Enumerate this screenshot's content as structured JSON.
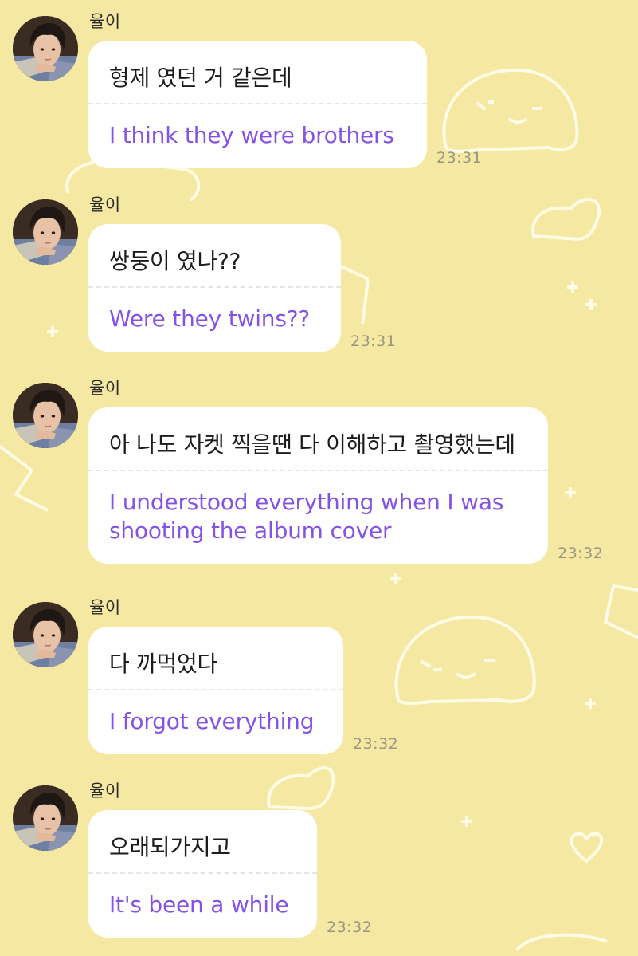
{
  "theme": {
    "background": "#f4e8a2",
    "bubble": "#ffffff",
    "original_text_color": "#1c1c1c",
    "translation_color": "#8553e4",
    "timestamp_color": "#9a9781",
    "doodle_color": "#fffbe6"
  },
  "messages": [
    {
      "sender": "율이",
      "original": "형제 였던 거 같은데",
      "translation": "I think they were brothers",
      "time": "23:31"
    },
    {
      "sender": "율이",
      "original": "쌍둥이 였나??",
      "translation": "Were they twins??",
      "time": "23:31"
    },
    {
      "sender": "율이",
      "original": "아 나도 자켓 찍을땐 다 이해하고 촬영했는데",
      "translation": "I understood everything when I was\nshooting the album cover",
      "time": "23:32"
    },
    {
      "sender": "율이",
      "original": "다 까먹었다",
      "translation": "I forgot everything",
      "time": "23:32"
    },
    {
      "sender": "율이",
      "original": "오래되가지고",
      "translation": "It's been a while",
      "time": "23:32"
    }
  ]
}
